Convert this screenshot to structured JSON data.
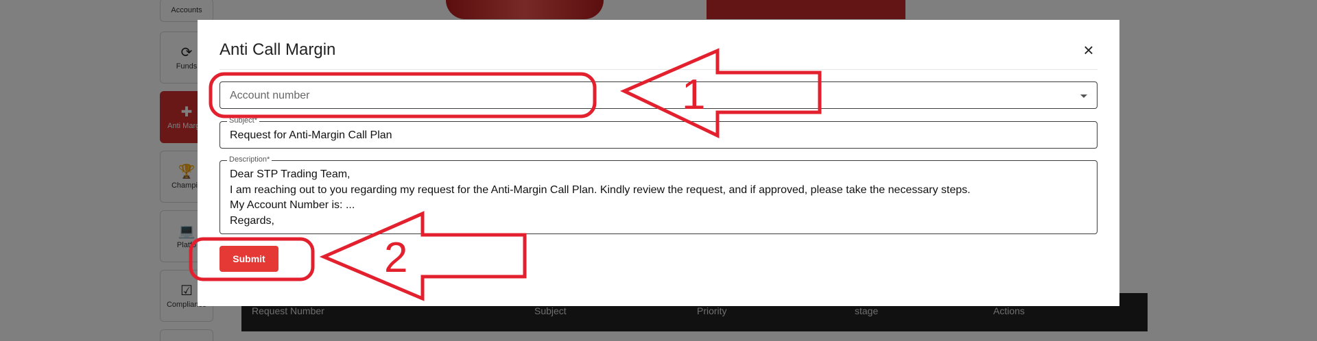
{
  "sidebar": {
    "items": [
      {
        "label": "Accounts",
        "icon": "accounts-icon"
      },
      {
        "label": "Funds",
        "icon": "funds-icon"
      },
      {
        "label": "Anti Margin",
        "icon": "anti-margin-icon",
        "active": true
      },
      {
        "label": "Champio",
        "icon": "trophy-icon"
      },
      {
        "label": "Platfo",
        "icon": "laptop-icon"
      },
      {
        "label": "Compliance",
        "icon": "compliance-icon"
      }
    ]
  },
  "table": {
    "headers": [
      "Request Number",
      "Subject",
      "Priority",
      "stage",
      "Actions"
    ]
  },
  "modal": {
    "title": "Anti Call Margin",
    "close_glyph": "×",
    "account": {
      "placeholder": "Account number"
    },
    "subject": {
      "label": "Subject*",
      "value": "Request for Anti-Margin Call Plan"
    },
    "description": {
      "label": "Description*",
      "lines": [
        "Dear STP Trading Team,",
        "I am reaching out to you regarding my request for the Anti-Margin Call Plan. Kindly review the request, and if approved, please take the necessary steps.",
        "My Account Number is: ...",
        "Regards,"
      ]
    },
    "submit_label": "Submit"
  },
  "annotations": {
    "step1": "1",
    "step2": "2",
    "color": "#e3202e"
  },
  "colors": {
    "accent": "#e53935",
    "overlay": "rgba(0,0,0,0.5)"
  }
}
